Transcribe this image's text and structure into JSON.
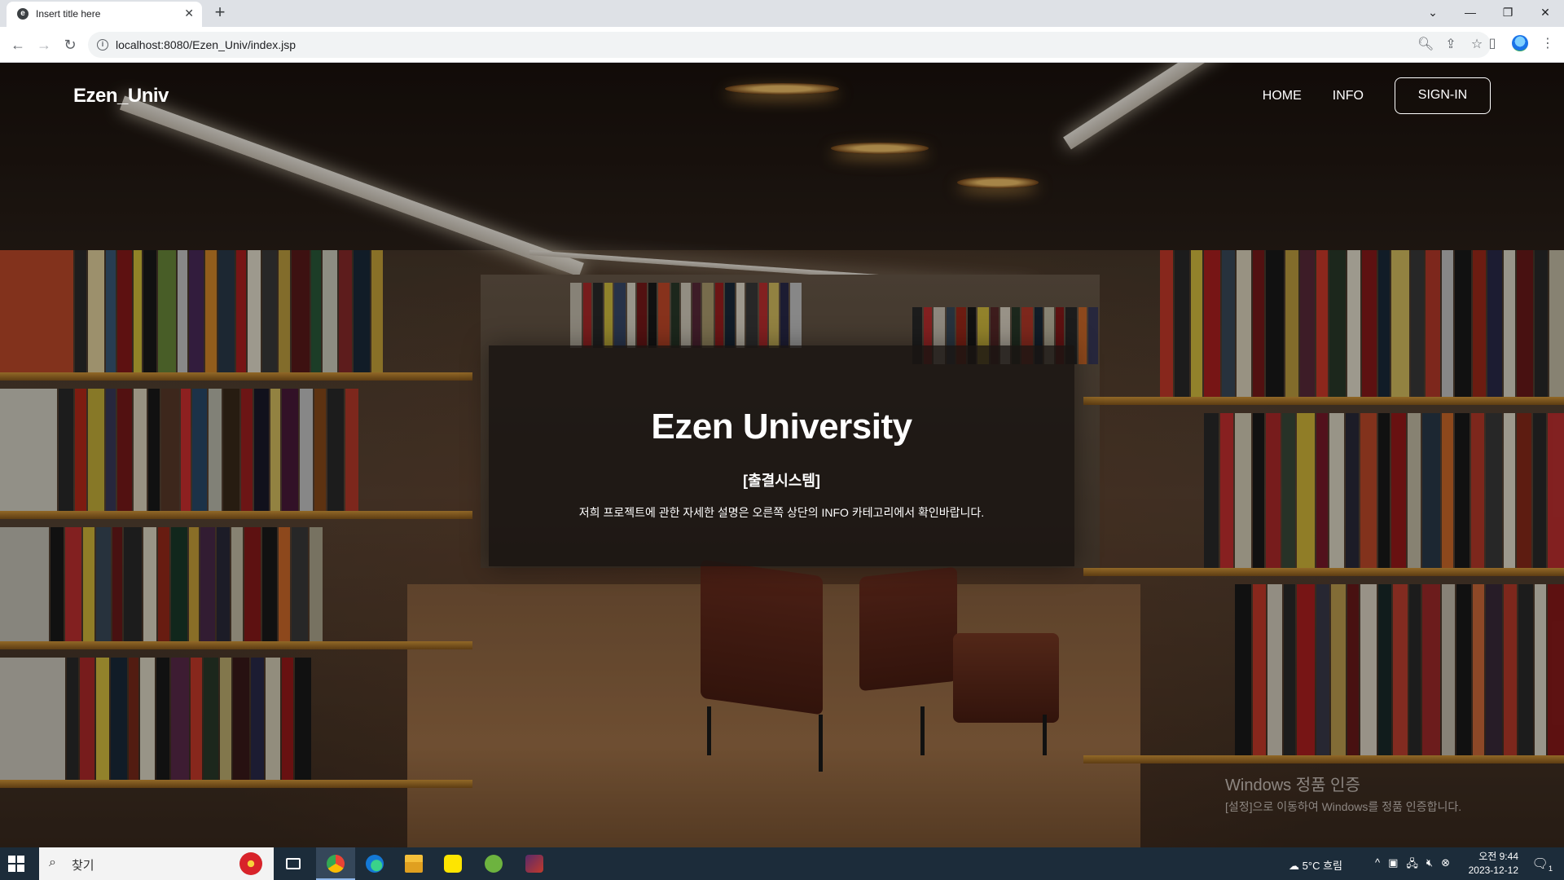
{
  "browser": {
    "tab_title": "Insert title here",
    "tab_favicon": "e-favicon",
    "new_tab_icon": "plus-icon",
    "url": "localhost:8080/Ezen_Univ/index.jsp",
    "window_controls": [
      "chevron-down-icon",
      "minimize-icon",
      "restore-icon",
      "close-icon"
    ]
  },
  "site": {
    "brand": "Ezen_Univ",
    "nav": [
      {
        "label": "HOME"
      },
      {
        "label": "INFO"
      }
    ],
    "signin_label": "SIGN-IN",
    "hero": {
      "title": "Ezen University",
      "subtitle": "[출결시스템]",
      "description": "저희 프로젝트에 관한 자세한 설명은 오른쪽 상단의 INFO 카테고리에서 확인바랍니다."
    }
  },
  "watermark": {
    "title": "Windows 정품 인증",
    "subtitle": "[설정]으로 이동하여 Windows를 정품 인증합니다."
  },
  "taskbar": {
    "search_placeholder": "찾기",
    "apps": [
      "task-view-icon",
      "chrome-icon",
      "edge-icon",
      "file-explorer-icon",
      "kakaotalk-icon",
      "spring-tool-icon",
      "game-icon"
    ],
    "weather": "5°C  흐림",
    "time": "오전 9:44",
    "date": "2023-12-12",
    "notification_count": "1"
  }
}
